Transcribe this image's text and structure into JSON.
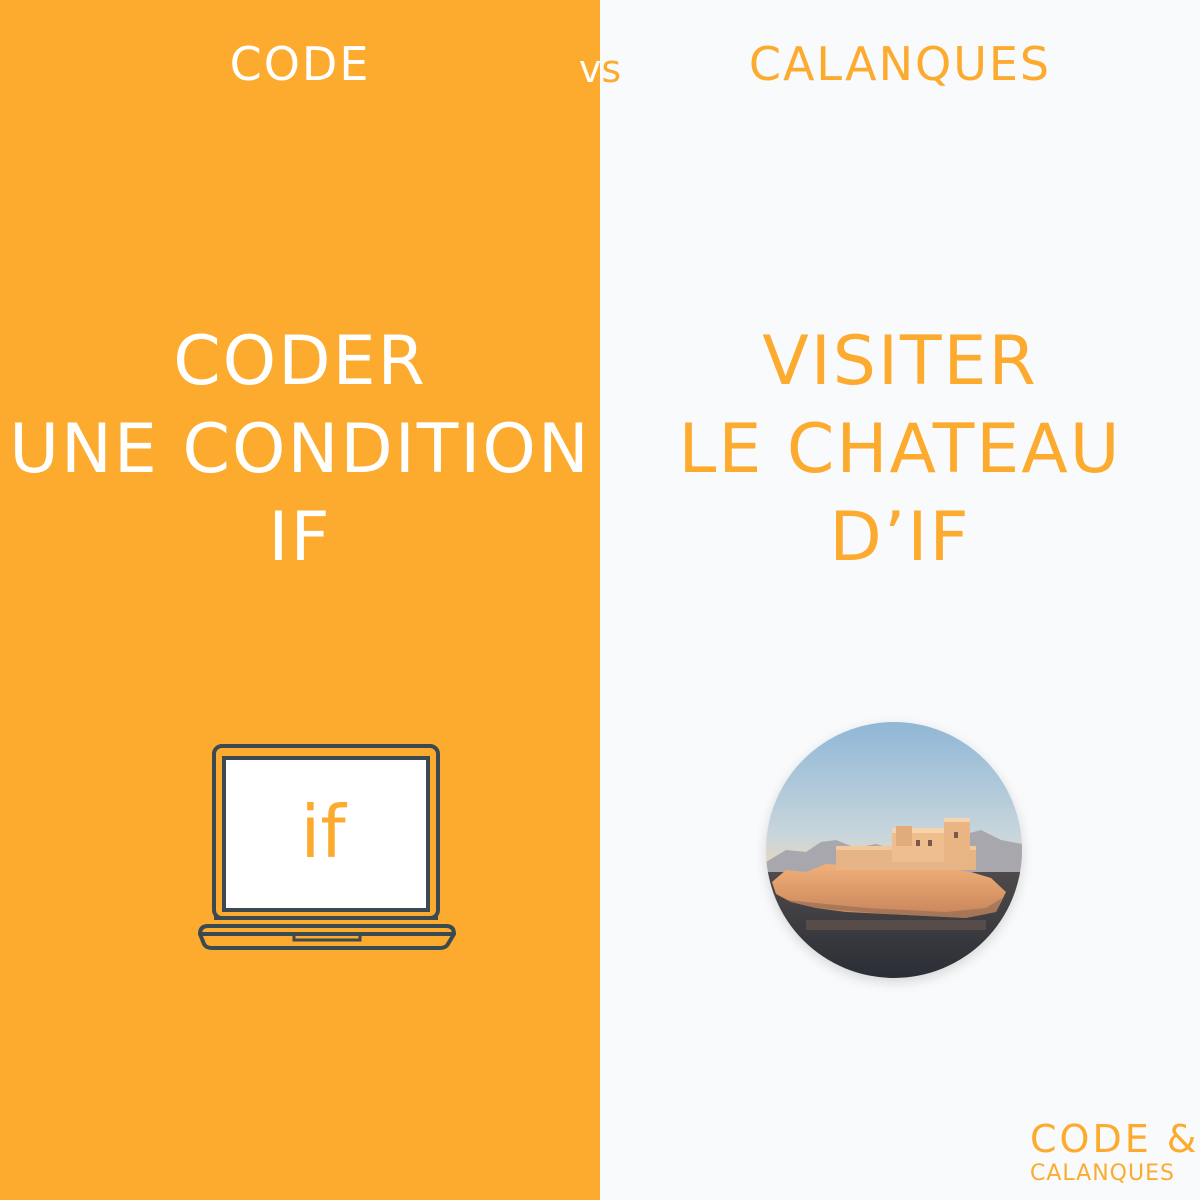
{
  "colors": {
    "orange": "#FCAB2F",
    "white": "#FFFFFF",
    "light_bg": "#F9FAFC",
    "laptop_outline": "#3B4A50"
  },
  "header": {
    "left_title": "CODE",
    "vs": "vs",
    "right_title": "CALANQUES"
  },
  "left": {
    "lines": [
      "CODER",
      "UNE CONDITION",
      "IF"
    ],
    "laptop_screen_text": "if",
    "icon": "laptop-icon"
  },
  "right": {
    "lines": [
      "VISITER",
      "LE CHATEAU",
      "D’IF"
    ],
    "image": "chateau-d-if-photo"
  },
  "logo": {
    "line1": "CODE &",
    "line2": "CALANQUES"
  }
}
